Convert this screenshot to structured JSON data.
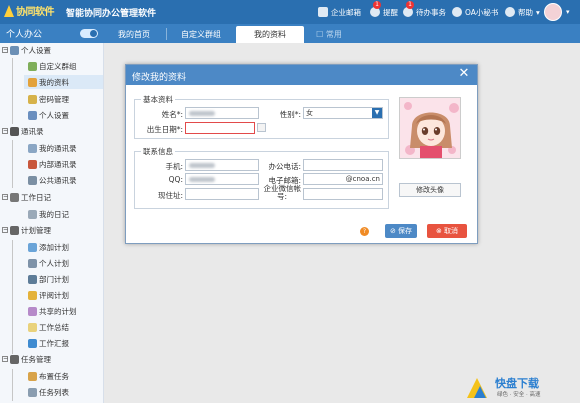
{
  "header": {
    "logo_text": "协同软件",
    "app_title": "智能协同办公管理软件",
    "actions": [
      {
        "label": "企业邮箱",
        "icon": "mail-icon"
      },
      {
        "label": "提醒",
        "icon": "bell-icon",
        "badge": "1"
      },
      {
        "label": "待办事务",
        "icon": "todo-icon",
        "badge": "1"
      },
      {
        "label": "OA小秘书",
        "icon": "secretary-icon"
      },
      {
        "label": "帮助",
        "icon": "help-icon"
      }
    ]
  },
  "subbar": {
    "module_title": "个人办公",
    "tabs": [
      {
        "label": "我的首页"
      },
      {
        "label": "自定义群组"
      },
      {
        "label": "我的资料"
      },
      {
        "label": "常用"
      }
    ]
  },
  "sidebar": {
    "groups": [
      {
        "label": "个人设置",
        "items": [
          "自定义群组",
          "我的资料",
          "密码管理",
          "个人设置"
        ]
      },
      {
        "label": "通讯录",
        "items": [
          "我的通讯录",
          "内部通讯录",
          "公共通讯录"
        ]
      },
      {
        "label": "工作日记",
        "items": [
          "我的日记"
        ]
      },
      {
        "label": "计划管理",
        "items": [
          "添加计划",
          "个人计划",
          "部门计划",
          "评阅计划",
          "共享的计划",
          "工作总结",
          "工作汇报"
        ]
      },
      {
        "label": "任务管理",
        "items": [
          "布置任务",
          "任务列表"
        ]
      }
    ]
  },
  "dialog": {
    "title": "修改我的资料",
    "basic": {
      "legend": "基本资料",
      "name_label": "姓名*:",
      "gender_label": "性别*:",
      "gender_value": "女",
      "birthday_label": "出生日期*:"
    },
    "contact": {
      "legend": "联系信息",
      "mobile_label": "手机:",
      "office_phone_label": "办公电话:",
      "qq_label": "QQ:",
      "email_label": "电子邮箱:",
      "email_value_suffix": "@cnoa.cn",
      "address_label": "现住址:",
      "wechat_label_1": "企业微信帐",
      "wechat_label_2": "号:"
    },
    "change_avatar": "修改头像",
    "save": "保存",
    "cancel": "取消"
  },
  "watermark": {
    "brand": "快盘下载",
    "slogan": "绿色 · 安全 · 高速"
  }
}
